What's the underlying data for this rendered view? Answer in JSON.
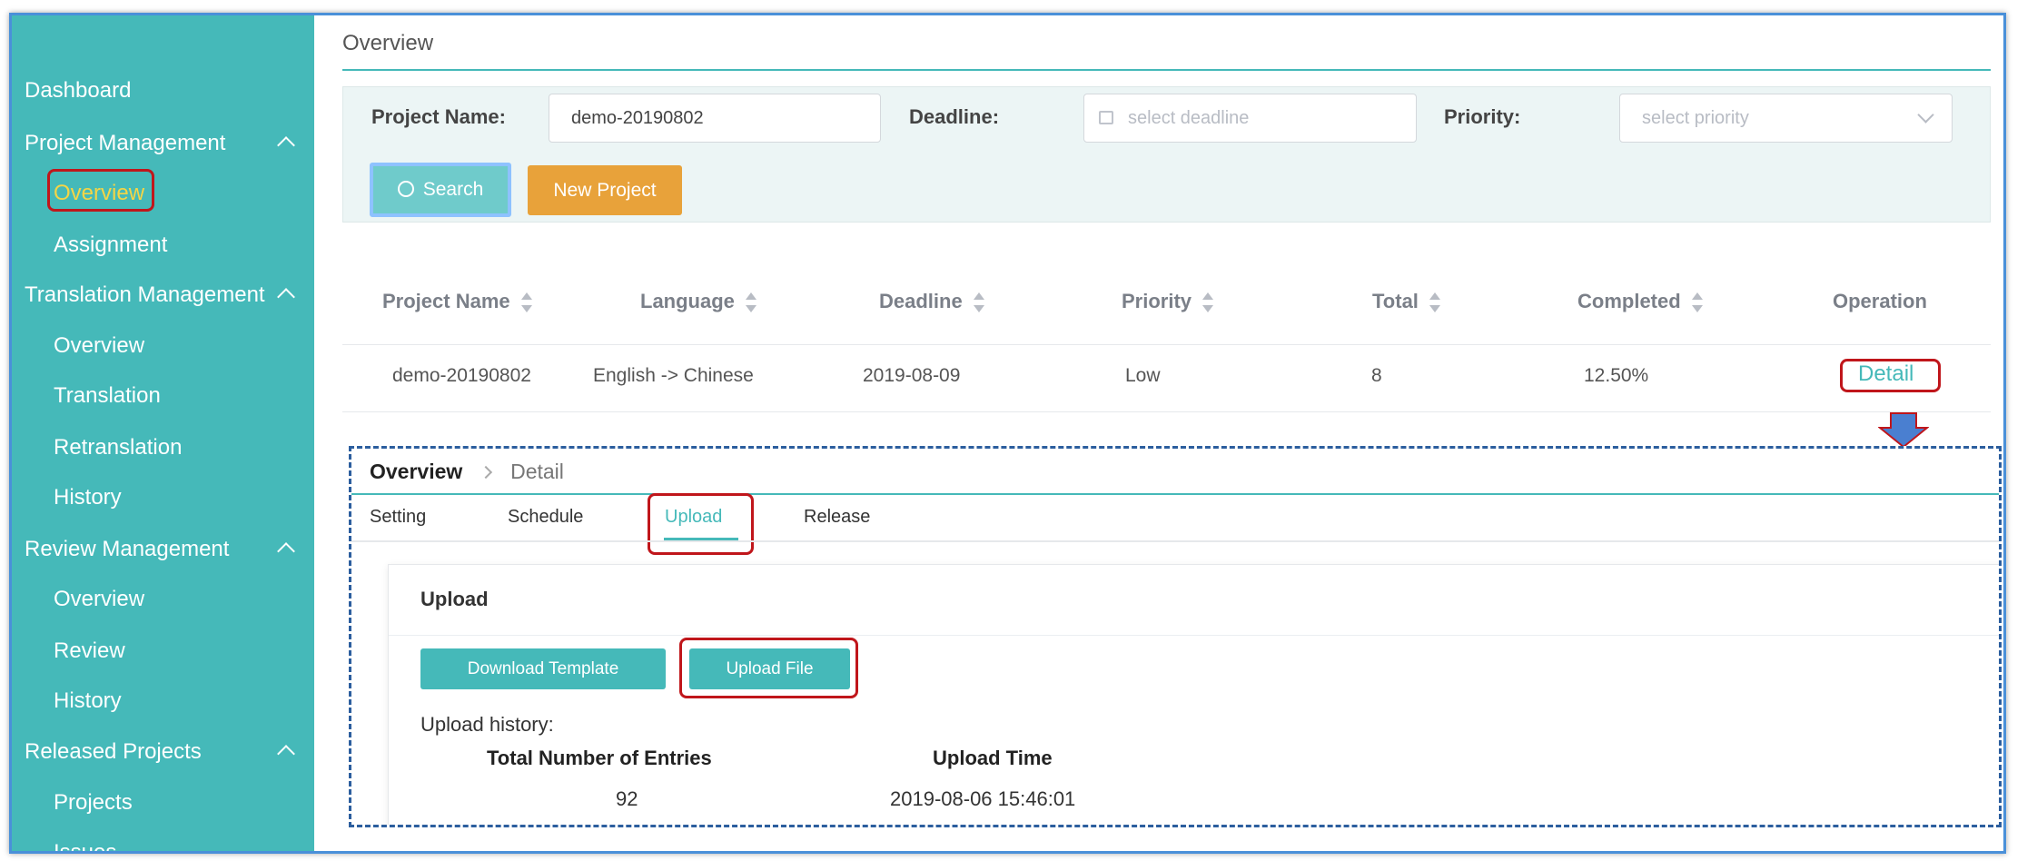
{
  "sidebar": {
    "dashboard": "Dashboard",
    "groups": [
      {
        "label": "Project Management",
        "items": [
          "Overview",
          "Assignment"
        ]
      },
      {
        "label": "Translation Management",
        "items": [
          "Overview",
          "Translation",
          "Retranslation",
          "History"
        ]
      },
      {
        "label": "Review Management",
        "items": [
          "Overview",
          "Review",
          "History"
        ]
      },
      {
        "label": "Released Projects",
        "items": [
          "Projects",
          "Issues"
        ]
      }
    ]
  },
  "page": {
    "title": "Overview"
  },
  "filter": {
    "project_name_label": "Project Name:",
    "project_name_value": "demo-20190802",
    "deadline_label": "Deadline:",
    "deadline_placeholder": "select deadline",
    "priority_label": "Priority:",
    "priority_placeholder": "select priority",
    "search_label": "Search",
    "new_project_label": "New Project"
  },
  "table": {
    "columns": [
      "Project Name",
      "Language",
      "Deadline",
      "Priority",
      "Total",
      "Completed",
      "Operation"
    ],
    "rows": [
      {
        "name": "demo-20190802",
        "language": "English -> Chinese",
        "deadline": "2019-08-09",
        "priority": "Low",
        "total": "8",
        "completed": "12.50%",
        "operation": "Detail"
      }
    ]
  },
  "detail": {
    "breadcrumb_root": "Overview",
    "breadcrumb_current": "Detail",
    "tabs": [
      "Setting",
      "Schedule",
      "Upload",
      "Release"
    ],
    "active_tab": "Upload",
    "card_title": "Upload",
    "download_template_label": "Download Template",
    "upload_file_label": "Upload File",
    "history_label": "Upload history:",
    "history_columns": [
      "Total Number of Entries",
      "Upload Time"
    ],
    "history_rows": [
      {
        "entries": "92",
        "time": "2019-08-06 15:46:01"
      }
    ]
  },
  "colors": {
    "sidebar": "#45b9b9",
    "accent": "#45b9b9",
    "orange": "#e8a23a",
    "highlight_box": "#c0161b",
    "active_nav": "#f5d545"
  }
}
